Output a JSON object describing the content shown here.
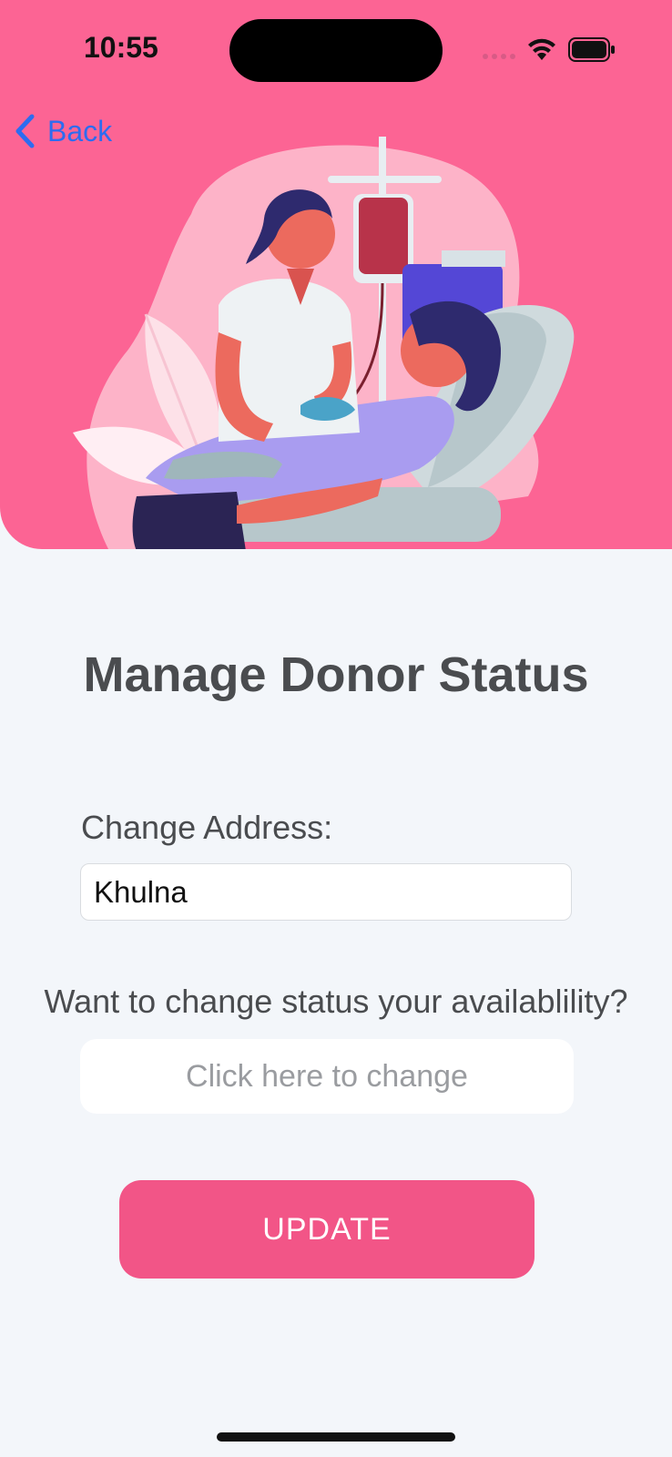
{
  "status_bar": {
    "time": "10:55",
    "icons": [
      "cellular-signal-icon",
      "wifi-icon",
      "battery-icon"
    ]
  },
  "nav": {
    "back_label": "Back",
    "back_icon": "chevron-left-icon",
    "accent_color": "#2d6cf0"
  },
  "hero": {
    "background_color": "#fc6494",
    "illustration": "blood-donation-illustration"
  },
  "page": {
    "title": "Manage Donor Status"
  },
  "form": {
    "address_label": "Change Address:",
    "address_value": "Khulna",
    "availability_question": "Want to change status your availablility?",
    "availability_button": "Click here to change",
    "update_button": "UPDATE",
    "update_color": "#f25587"
  }
}
